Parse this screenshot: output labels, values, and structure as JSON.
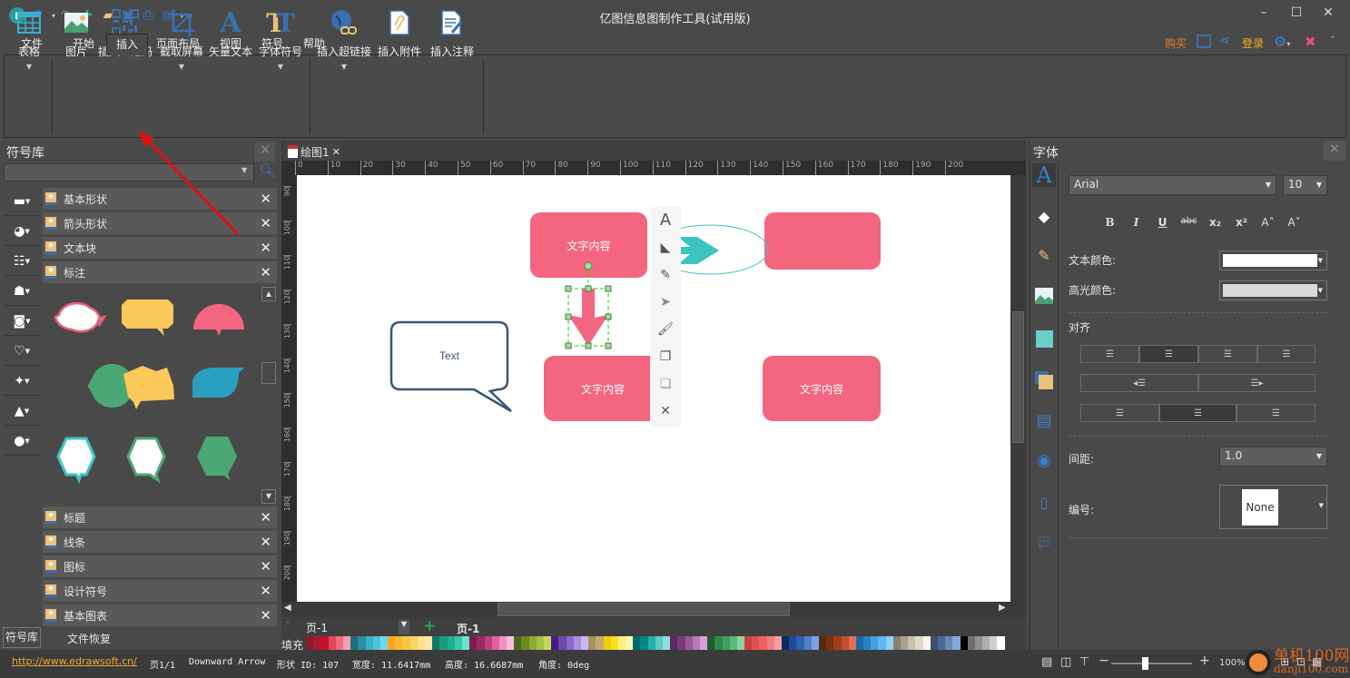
{
  "app": {
    "title": "亿图信息图制作工具(试用版)"
  },
  "quick_access": [
    "app-logo-icon",
    "undo-icon",
    "redo-icon",
    "new-icon",
    "open-icon",
    "save-icon",
    "print-icon",
    "export-icon"
  ],
  "menu_tabs": [
    "文件",
    "开始",
    "插入",
    "页面布局",
    "视图",
    "符号",
    "帮助"
  ],
  "active_tab": "插入",
  "top_right": {
    "buy": "购买",
    "login": "登录"
  },
  "ribbon": {
    "groups": [
      {
        "items": [
          {
            "label": "表格",
            "icon": "table-icon",
            "dropdown": true
          }
        ]
      },
      {
        "items": [
          {
            "label": "图片",
            "icon": "image-icon"
          },
          {
            "label": "插入二维码",
            "icon": "qrcode-icon"
          },
          {
            "label": "截取屏幕",
            "icon": "crop-icon",
            "dropdown": true
          },
          {
            "label": "矢量文本",
            "icon": "vector-text-icon"
          },
          {
            "label": "字体符号",
            "icon": "font-symbol-icon",
            "dropdown": true
          }
        ]
      },
      {
        "items": [
          {
            "label": "插入超链接",
            "icon": "hyperlink-icon",
            "dropdown": true
          },
          {
            "label": "插入附件",
            "icon": "attachment-icon"
          },
          {
            "label": "插入注释",
            "icon": "note-icon"
          }
        ]
      }
    ]
  },
  "library": {
    "title": "符号库",
    "search_placeholder": "",
    "categories_top": [
      "基本形状",
      "箭头形状",
      "文本块",
      "标注"
    ],
    "categories_bottom": [
      "标题",
      "线条",
      "图标",
      "设计符号",
      "基本图表"
    ],
    "bottom_tabs": [
      "符号库",
      "文件恢复"
    ]
  },
  "document": {
    "tab": "绘图1",
    "ruler_h": [
      "0",
      "10",
      "20",
      "30",
      "40",
      "50",
      "60",
      "70",
      "80",
      "90",
      "100",
      "110",
      "120",
      "130",
      "140",
      "150",
      "160",
      "170",
      "180",
      "190",
      "200"
    ],
    "ruler_v": [
      "90",
      "100",
      "110",
      "120",
      "130",
      "140",
      "150",
      "160",
      "170",
      "180",
      "190",
      "200"
    ],
    "shapes": {
      "box_text": "文字内容",
      "callout_text": "Text"
    },
    "page_select": "页-1",
    "page_tab": "页-1",
    "fill_label": "填充",
    "colors": {
      "pink": "#f4667f",
      "teal": "#3cc4c0",
      "callout_border": "#3b5575",
      "selection": "#00dd00"
    }
  },
  "palette": [
    "#8b1a2a",
    "#a51c30",
    "#c8102e",
    "#e0455e",
    "#f06a80",
    "#f4a0b0",
    "#1f6f7a",
    "#2a8fa0",
    "#38b0c8",
    "#4cc4dc",
    "#70d8ee",
    "#f5a623",
    "#f7b731",
    "#fbc740",
    "#fdd465",
    "#fde08a",
    "#fee8a8",
    "#0f7a6a",
    "#1a9a80",
    "#20b090",
    "#3cc8a8",
    "#70e0c8",
    "#7a1f4a",
    "#9a2a62",
    "#c0407a",
    "#e060a0",
    "#f090c0",
    "#f8c0d8",
    "#4a6a1a",
    "#6a8a20",
    "#8aaa30",
    "#a8c040",
    "#c8d860",
    "#4a1a8a",
    "#6a4aaa",
    "#8a6ac8",
    "#a890dc",
    "#c8b8f0",
    "#a89060",
    "#c8a870",
    "#f0d000",
    "#f8e020",
    "#fbf080",
    "#fff8b0",
    "#006a6a",
    "#008a8a",
    "#20b0b0",
    "#60c8c8",
    "#90dcd8",
    "#5a2a5a",
    "#7a3a7a",
    "#9a5a9a",
    "#b87ab8",
    "#d8a0d8",
    "#205a30",
    "#2e8a4a",
    "#40a060",
    "#60b878",
    "#90d0a0",
    "#c84040",
    "#e05050",
    "#f06060",
    "#f08080",
    "#f8a0a0",
    "#102a60",
    "#1a4a9a",
    "#3060b0",
    "#5080c8",
    "#80a0e0",
    "#5a2a0a",
    "#7a3010",
    "#a0401a",
    "#c05030",
    "#e07050",
    "#1a6aaa",
    "#2a80c8",
    "#40a0e0",
    "#60b8f0",
    "#90d0f8",
    "#8a8070",
    "#a8a090",
    "#c8c0a8",
    "#e0d8c8",
    "#f8f4ec",
    "#3a5070",
    "#4a6a90",
    "#6a88b0",
    "#80a8e0",
    "#000000",
    "#707070",
    "#909090",
    "#b0b0b0",
    "#d0d0d0",
    "#ffffff"
  ],
  "font_panel": {
    "title": "字体",
    "font": "Arial",
    "size": "10",
    "styles": [
      "B",
      "I",
      "U",
      "abc",
      "x₂",
      "x²",
      "A˄",
      "A˅"
    ],
    "text_color_label": "文本颜色:",
    "text_color": "#ffffff",
    "highlight_label": "高光颜色:",
    "highlight_color": "#d9d9d9",
    "align_label": "对齐",
    "spacing_label": "间距:",
    "spacing": "1.0",
    "numbering_label": "编号:",
    "numbering": "None"
  },
  "status": {
    "url": "http://www.edrawsoft.cn/",
    "page": "页1/1",
    "shape_name": "Downward Arrow",
    "shape_id": "形状 ID: 107",
    "width": "宽度: 11.6417mm",
    "height": "高度: 16.6687mm",
    "angle": "角度: 0deg",
    "zoom": "100%",
    "zoom_level": 0.42
  },
  "watermark": {
    "text": "单机100网",
    "url": "danji100.com"
  }
}
